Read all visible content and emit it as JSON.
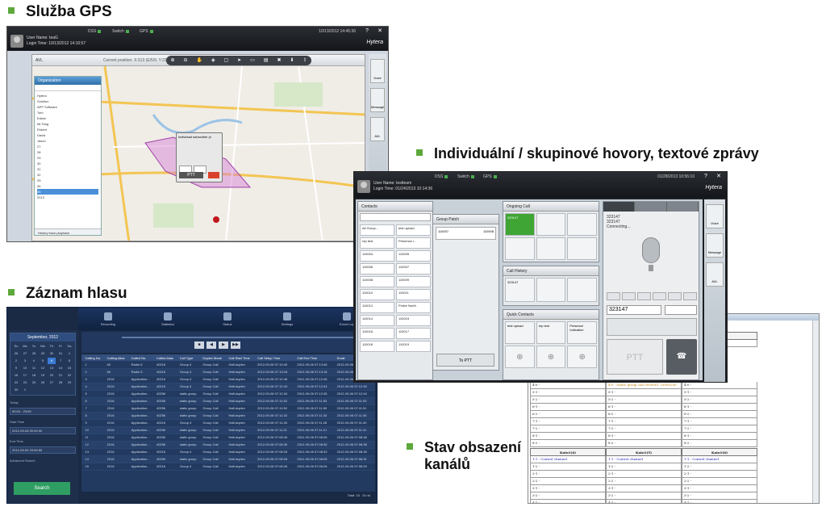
{
  "headings": {
    "gps": "Služba GPS",
    "calls": "Individuální / skupinové  hovory,  textové zprávy",
    "recording": "Záznam hlasu",
    "channels_line1": "Stav obsazení",
    "channels_line2": "kanálů"
  },
  "gps_window": {
    "services": [
      "DSS",
      "Switch",
      "GPS"
    ],
    "user_name": "User Name: teaG",
    "login_time": "Login Time: 10/13/2012 14:10:57",
    "clock": "10/13/2012 14:45:36",
    "logo": "Hytera",
    "avl_label": "AVL",
    "current_position": "Current position: X:313 (E/5/9, Y:22.554151",
    "organization_title": "Organization",
    "tree": [
      "Hytera",
      "Solution",
      "APP Software",
      "Tom",
      "Edwin",
      "Mr.Tang",
      "Robert",
      "David",
      "Jason",
      "27",
      "28",
      "29",
      "30",
      "31",
      "32",
      "33",
      "34",
      "35",
      "2013"
    ],
    "history_playback": "History track playback",
    "popup_title": "Individual subscriber pi",
    "popup_ptt": "PTT",
    "side_buttons": [
      "Voice",
      "Message",
      "AVL"
    ]
  },
  "calls_window": {
    "services": [
      "DSS",
      "Switch",
      "GPS"
    ],
    "user_name": "User Name: testteam",
    "login_time": "Login Time: 01/24/2013 10:14:36",
    "clock": "01/28/2013 10:56:10",
    "logo": "Hytera",
    "contacts_title": "Contacts",
    "group_patch_title": "Group Patch",
    "ongoing_title": "Ongoing Call",
    "history_title": "Call History",
    "quick_title": "Quick Contacts",
    "contacts": [
      [
        "All Group...",
        "test upload"
      ],
      [
        "rep test",
        "Presence i..."
      ],
      [
        "110004",
        "110005"
      ],
      [
        "110006",
        "110007"
      ],
      [
        "110008",
        "110009"
      ],
      [
        "110010",
        "110011"
      ],
      [
        "110012",
        "Police North"
      ],
      [
        "110014",
        "110015"
      ],
      [
        "110016",
        "110017"
      ],
      [
        "110018",
        "110019"
      ]
    ],
    "group_patch_items": [
      "110007",
      "110008"
    ],
    "to_ptt": "To PTT",
    "ongoing_active": "323147",
    "history_item": "323147",
    "quick_contacts": [
      "test upload",
      "rep test",
      "Presence Indication"
    ],
    "dial_number": "323147",
    "dial_status": "Connecting...",
    "dial_input": "323147",
    "ptt_label": "PTT",
    "side_buttons": [
      "Voice",
      "Message",
      "AVL"
    ]
  },
  "recording_window": {
    "nav": [
      "Recording",
      "Statistics",
      "Status",
      "Settings",
      "Event Log"
    ],
    "calendar_title": "September, 2012",
    "weekdays": [
      "Su",
      "Mo",
      "Tu",
      "We",
      "Th",
      "Fr",
      "Sa"
    ],
    "calendar_days": [
      "26",
      "27",
      "28",
      "29",
      "30",
      "31",
      "1",
      "2",
      "3",
      "4",
      "5",
      "6",
      "7",
      "8",
      "9",
      "10",
      "11",
      "12",
      "13",
      "14",
      "15",
      "16",
      "17",
      "18",
      "19",
      "20",
      "21",
      "22",
      "23",
      "24",
      "25",
      "26",
      "27",
      "28",
      "29",
      "30",
      "1"
    ],
    "today_label": "Today",
    "time_range": "00:00 - 23:59",
    "start_time_label": "Start Time",
    "start_time": "2012-09-06 00:00:00",
    "end_time_label": "End Time",
    "end_time": "2012-09-06 23:59:59",
    "advanced_search": "Advanced Search",
    "search_button": "Search",
    "columns": [
      "",
      "Calling No.",
      "Calling Alias",
      "Called No.",
      "Called Alias",
      "Call Type",
      "Duplex Mode",
      "Call Start Time",
      "Call Setup Time",
      "Call End Time",
      "Durat"
    ],
    "rows": [
      [
        "1",
        "60",
        "Radio 6",
        "40216",
        "Group 4",
        "Group Call",
        "Half-duplex",
        "2012-09-06 07:13:40",
        "2012-09-06 07:13:45",
        "2012-09-06 07:13:40"
      ],
      [
        "2",
        "60",
        "Radio 6",
        "40216",
        "Group 4",
        "Group Call",
        "Half-duplex",
        "2012-09-06 07:13:18",
        "2012-09-06 07:13:18",
        "2012-09-06 07:13:24"
      ],
      [
        "3",
        "2016",
        "Application...",
        "40216",
        "Group 4",
        "Group Call",
        "Half-duplex",
        "2012-09-06 07:12:48",
        "2012-09-06 07:12:48",
        "2012-09-06 07:12:50"
      ],
      [
        "4",
        "2016",
        "Application...",
        "40216",
        "Group 4",
        "Group Call",
        "Half-duplex",
        "2012-09-06 07:12:43",
        "2012-09-06 07:12:43",
        "2012-09-06 07:12:45"
      ],
      [
        "5",
        "2016",
        "Application...",
        "40256",
        "static group",
        "Group Call",
        "Half-duplex",
        "2012-09-06 07:12:34",
        "2012-09-06 07:12:35",
        "2012-09-06 07:12:44"
      ],
      [
        "6",
        "2016",
        "Application...",
        "40256",
        "static group",
        "Group Call",
        "Half-duplex",
        "2012-09-06 07:11:53",
        "2012-09-06 07:11:53",
        "2012-09-06 07:11:53"
      ],
      [
        "7",
        "2016",
        "Application...",
        "40256",
        "static group",
        "Group Call",
        "Half-duplex",
        "2012-09-06 07:11:50",
        "2012-09-06 07:11:50",
        "2012-09-06 07:11:51"
      ],
      [
        "8",
        "2016",
        "Application...",
        "40256",
        "static group",
        "Group Call",
        "Half-duplex",
        "2012-09-06 07:11:33",
        "2012-09-06 07:11:33",
        "2012-09-06 07:11:35"
      ],
      [
        "9",
        "2016",
        "Application...",
        "40216",
        "Group 4",
        "Group Call",
        "Half-duplex",
        "2012-09-06 07:11:28",
        "2012-09-06 07:11:28",
        "2012-09-06 07:11:30"
      ],
      [
        "10",
        "2016",
        "Application...",
        "40256",
        "static group",
        "Group Call",
        "Half-duplex",
        "2012-09-06 07:11:21",
        "2012-09-06 07:11:21",
        "2012-09-06 07:11:31"
      ],
      [
        "11",
        "2016",
        "Application...",
        "40256",
        "static group",
        "Group Call",
        "Half-duplex",
        "2012-09-06 07:08:45",
        "2012-09-06 07:08:45",
        "2012-09-06 07:08:48"
      ],
      [
        "12",
        "2016",
        "Application...",
        "40256",
        "static group",
        "Group Call",
        "Half-duplex",
        "2012-09-06 07:08:35",
        "2012-09-06 07:08:35",
        "2012-09-06 07:08:38"
      ],
      [
        "13",
        "2016",
        "Application...",
        "40216",
        "Group 4",
        "Group Call",
        "Half-duplex",
        "2012-09-06 07:08:33",
        "2012-09-06 07:08:33",
        "2012-09-06 07:08:35"
      ],
      [
        "14",
        "2016",
        "Application...",
        "40256",
        "static group",
        "Group Call",
        "Half-duplex",
        "2012-09-06 07:08:28",
        "2012-09-06 07:08:28",
        "2012-09-06 07:08:31"
      ],
      [
        "15",
        "2016",
        "Application...",
        "40216",
        "Group 4",
        "Group Call",
        "Half-duplex",
        "2012-09-06 07:08:26",
        "2012-09-06 07:08:26",
        "2012-09-06 07:08:29"
      ]
    ],
    "total_label": "Total: 15",
    "page_label": "Go to"
  },
  "channel_window": {
    "top_header": "TSC3(0)",
    "top_rows": [
      "Control channel"
    ],
    "groups": [
      {
        "rows": [
          "4-0 -",
          "5-1 -",
          "5-2 -",
          "6-1 -",
          "6-2 -",
          "7-1 -",
          "7-2 -",
          "8-1 -",
          "8-2 -"
        ]
      },
      {
        "rows": [
          "4-0 - Static group  call 0000001  20000200",
          "5-1 -",
          "5-2 -",
          "6-1 -",
          "6-2 -",
          "7-1 -",
          "7-2 -",
          "8-1 -",
          "8-2 -"
        ]
      },
      {
        "rows": [
          "4-0 -",
          "5-1 -",
          "5-2 -",
          "6-1 -",
          "6-2 -",
          "7-1 -",
          "7-2 -",
          "8-1 -",
          "8-2 -"
        ]
      }
    ],
    "bottom_headers": [
      "Kato1(4)",
      "Kato1(5)",
      "Kato1(6)"
    ],
    "bottom_rows": [
      [
        "1-1 -  Control channel",
        "1-1 -  Control channel",
        "1-1 -  Control channel"
      ],
      [
        "1-2 -",
        "1-2 -",
        "1-2 -"
      ],
      [
        "2-1 -",
        "2-1 -",
        "2-1 -"
      ],
      [
        "2-2 -",
        "2-2 -",
        "2-2 -"
      ],
      [
        "3-1 -",
        "3-1 -",
        "3-1 -"
      ],
      [
        "3-2 -",
        "3-2 -",
        "3-2 -"
      ],
      [
        "4-1 -",
        "4-1 -",
        "4-1 -"
      ]
    ]
  }
}
